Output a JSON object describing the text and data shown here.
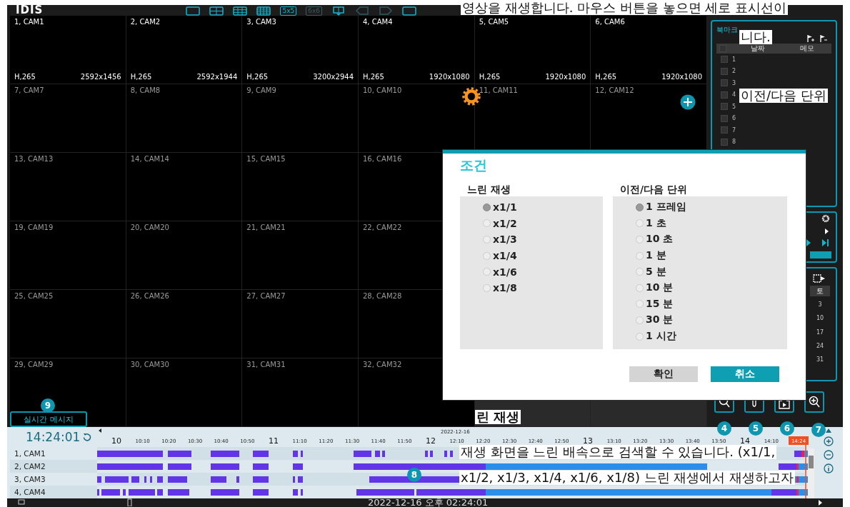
{
  "toolbar": {
    "logo": "IDIS",
    "layout_buttons": [
      {
        "kind": "grid-1"
      },
      {
        "kind": "grid-2"
      },
      {
        "kind": "grid-3"
      },
      {
        "kind": "grid-4"
      },
      {
        "kind": "text",
        "label": "5x5",
        "disabled": false
      },
      {
        "kind": "text",
        "label": "6x6",
        "disabled": true
      },
      {
        "kind": "split"
      },
      {
        "kind": "prev"
      },
      {
        "kind": "next"
      },
      {
        "kind": "full"
      }
    ]
  },
  "camera_rows": [
    [
      {
        "name": "1, CAM1",
        "codec": "H,265",
        "resolution": "2592x1456"
      },
      {
        "name": "2, CAM2",
        "codec": "H,265",
        "resolution": "2592x1944"
      },
      {
        "name": "3, CAM3",
        "codec": "H,265",
        "resolution": "3200x2944"
      },
      {
        "name": "4, CAM4",
        "codec": "H,265",
        "resolution": "1920x1080"
      },
      {
        "name": "5, CAM5",
        "codec": "H,265",
        "resolution": "1920x1080"
      },
      {
        "name": "6, CAM6",
        "codec": "H,265",
        "resolution": "1920x1080"
      }
    ],
    [
      {
        "name": "7, CAM7"
      },
      {
        "name": "8, CAM8"
      },
      {
        "name": "9, CAM9"
      },
      {
        "name": "10, CAM10"
      },
      {
        "name": "11, CAM11"
      },
      {
        "name": "12, CAM12"
      }
    ],
    [
      {
        "name": "13, CAM13"
      },
      {
        "name": "14, CAM14"
      },
      {
        "name": "15, CAM15"
      },
      {
        "name": "16, CAM16"
      }
    ],
    [
      {
        "name": "19, CAM19"
      },
      {
        "name": "20, CAM20"
      },
      {
        "name": "21, CAM21"
      },
      {
        "name": "22, CAM22"
      }
    ],
    [
      {
        "name": "25, CAM25"
      },
      {
        "name": "26, CAM26"
      },
      {
        "name": "27, CAM27"
      },
      {
        "name": "28, CAM28"
      }
    ],
    [
      {
        "name": "29, CAM29"
      },
      {
        "name": "30, CAM30"
      },
      {
        "name": "31, CAM31"
      },
      {
        "name": "32, CAM32"
      }
    ]
  ],
  "bookmarks": {
    "title": "북마크",
    "columns": [
      "날짜",
      "메모"
    ],
    "header_checked": false,
    "rows": [
      {
        "label": "1",
        "checked": false
      },
      {
        "label": "2",
        "checked": false
      },
      {
        "label": "3",
        "checked": false
      },
      {
        "label": "4",
        "checked": false
      },
      {
        "label": "5",
        "checked": false
      },
      {
        "label": "6",
        "checked": false
      },
      {
        "label": "7",
        "checked": false
      },
      {
        "label": "8",
        "checked": false
      }
    ]
  },
  "calendar": {
    "weekday": "토",
    "dates": [
      "3",
      "10",
      "17",
      "24",
      "31"
    ]
  },
  "realtime_message": {
    "label": "실시간 메시지"
  },
  "timeline": {
    "clock": "14:24:01",
    "date": "2022-12-16",
    "hours": [
      "10",
      "11",
      "12",
      "13",
      "14"
    ],
    "minute_ticks": [
      "10:10",
      "10:20",
      "10:30",
      "10:40",
      "10:50",
      "11:10",
      "11:20",
      "11:30",
      "11:40",
      "11:50",
      "12:10",
      "12:20",
      "12:30",
      "12:40",
      "12:50",
      "13:10",
      "13:20",
      "13:30",
      "13:40",
      "13:50",
      "14:10"
    ],
    "cursor_label": "14:24",
    "cameras": [
      "1, CAM1",
      "2, CAM2",
      "3, CAM3",
      "4, CAM4"
    ]
  },
  "status_bar": {
    "datetime": "2022-12-16 오후 02:24:01"
  },
  "dialog": {
    "title": "조건",
    "groups": [
      {
        "title": "느린 재생",
        "options": [
          {
            "label": "x1/1",
            "selected": true
          },
          {
            "label": "x1/2",
            "selected": false
          },
          {
            "label": "x1/3",
            "selected": false
          },
          {
            "label": "x1/4",
            "selected": false
          },
          {
            "label": "x1/6",
            "selected": false
          },
          {
            "label": "x1/8",
            "selected": false
          }
        ]
      },
      {
        "title": "이전/다음 단위",
        "options": [
          {
            "label": "1 프레임",
            "selected": true
          },
          {
            "label": "1 초",
            "selected": false
          },
          {
            "label": "10 초",
            "selected": false
          },
          {
            "label": "1 분",
            "selected": false
          },
          {
            "label": "5 분",
            "selected": false
          },
          {
            "label": "10 분",
            "selected": false
          },
          {
            "label": "15 분",
            "selected": false
          },
          {
            "label": "30 분",
            "selected": false
          },
          {
            "label": "1 시간",
            "selected": false
          }
        ]
      }
    ],
    "buttons": [
      {
        "label": "확인",
        "kind": "secondary"
      },
      {
        "label": "취소",
        "kind": "primary"
      }
    ]
  },
  "callouts": [
    {
      "label": "9"
    },
    {
      "label": "4"
    },
    {
      "label": "5"
    },
    {
      "label": "6"
    },
    {
      "label": "7"
    },
    {
      "label": "8"
    }
  ],
  "manual_text": [
    {
      "kind": "body",
      "text": "영상을 재생합니다. 마우스 버튼을 놓으면 세로 표시선이"
    },
    {
      "kind": "body",
      "text": "니다."
    },
    {
      "kind": "body",
      "text": "이전/다음 단위"
    },
    {
      "kind": "heading",
      "text": "린 재생"
    },
    {
      "kind": "body",
      "text": "재생 화면을 느린 배속으로 검색할 수 있습니다. (x1/1,"
    },
    {
      "kind": "body",
      "text": "x1/2, x1/3, x1/4, x1/6, x1/8) 느린 재생에서 재생하고자"
    }
  ]
}
